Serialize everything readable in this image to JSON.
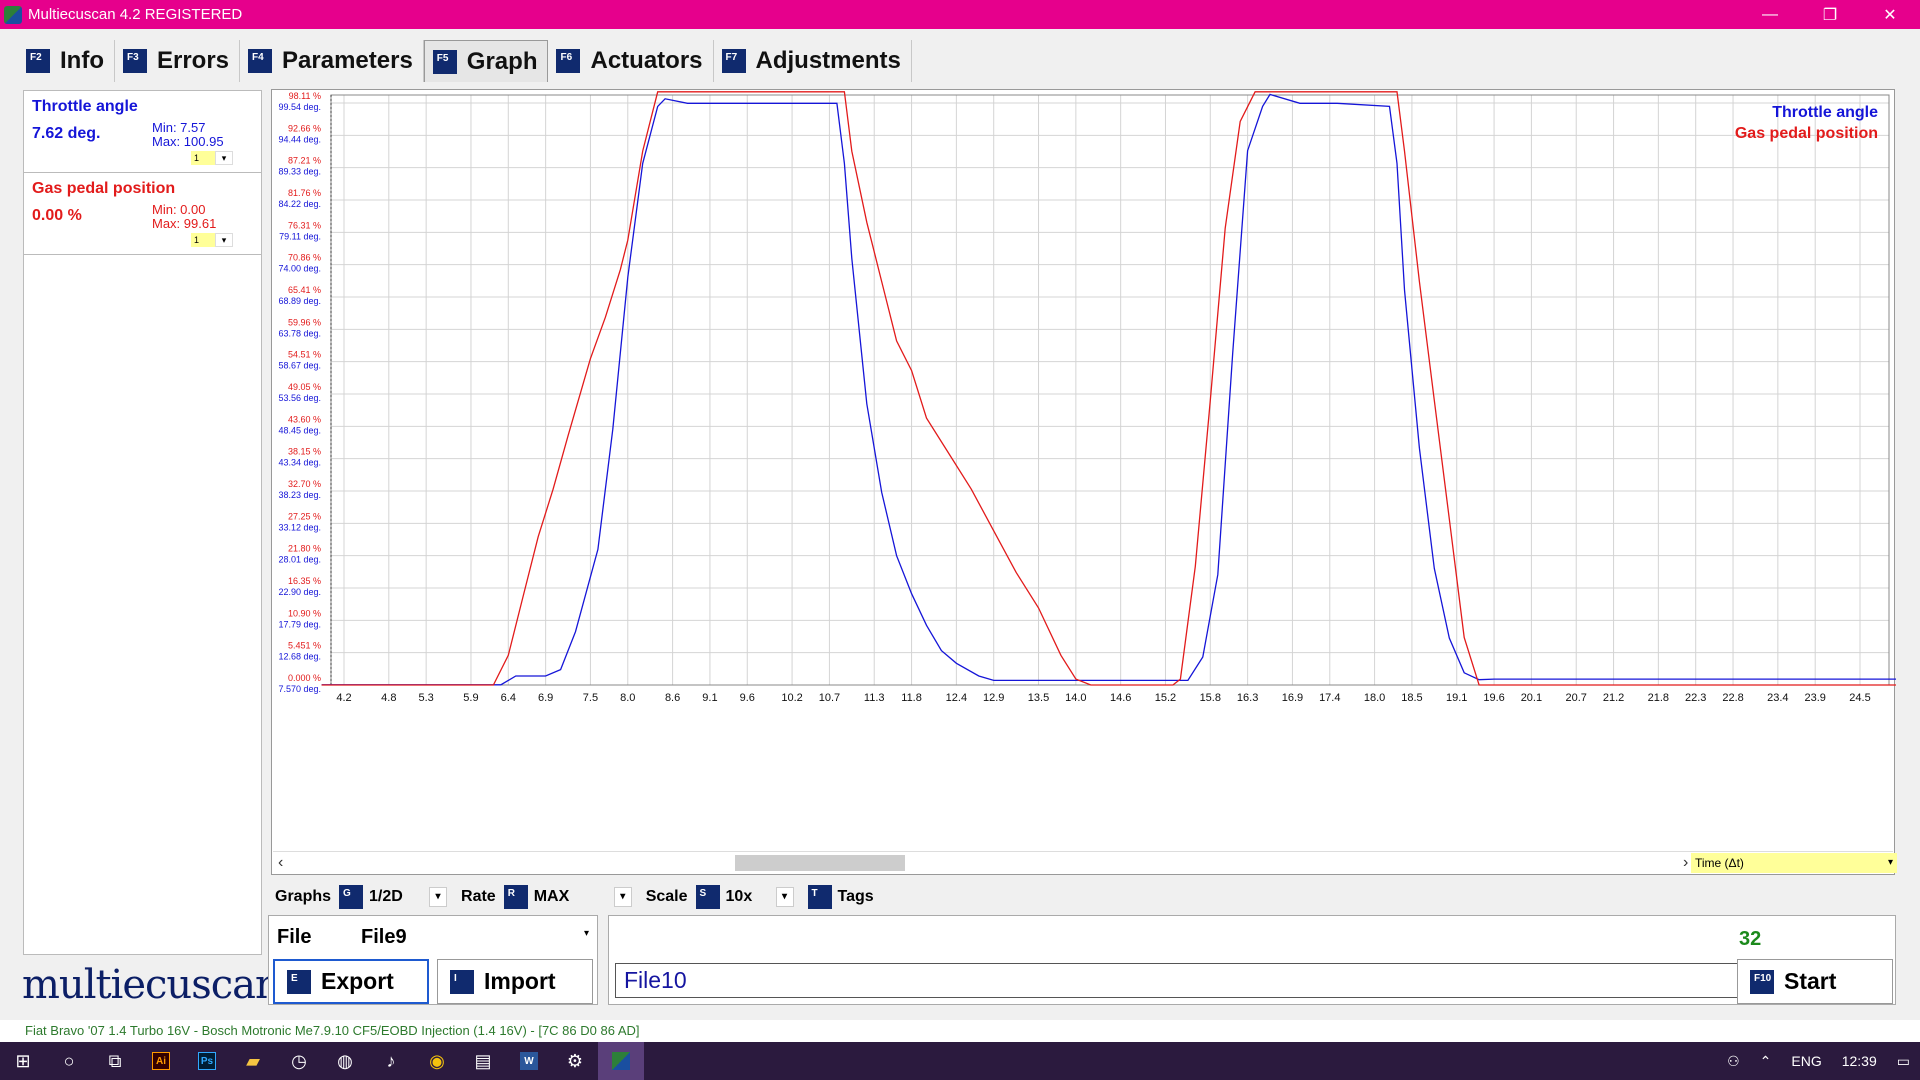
{
  "window": {
    "title": "Multiecuscan 4.2 REGISTERED",
    "min": "—",
    "restore": "❐",
    "close": "✕"
  },
  "tabs": [
    {
      "key": "F2",
      "label": "Info"
    },
    {
      "key": "F3",
      "label": "Errors"
    },
    {
      "key": "F4",
      "label": "Parameters"
    },
    {
      "key": "F5",
      "label": "Graph"
    },
    {
      "key": "F6",
      "label": "Actuators"
    },
    {
      "key": "F7",
      "label": "Adjustments"
    }
  ],
  "signals": [
    {
      "name": "Throttle angle",
      "value": "7.62 deg.",
      "min": "Min: 7.57",
      "max": "Max: 100.95",
      "scale": "1",
      "color": "#1515d8"
    },
    {
      "name": "Gas pedal position",
      "value": "0.00 %",
      "min": "Min: 0.00",
      "max": "Max: 99.61",
      "scale": "1",
      "color": "#e21b1b"
    }
  ],
  "logo": "multiecuscan",
  "chart_data": {
    "type": "line",
    "title": "",
    "xlabel": "Time (Δt)",
    "x_ticks": [
      "4.2",
      "4.8",
      "5.3",
      "5.9",
      "6.4",
      "6.9",
      "7.5",
      "8.0",
      "8.6",
      "9.1",
      "9.6",
      "10.2",
      "10.7",
      "11.3",
      "11.8",
      "12.4",
      "12.9",
      "13.5",
      "14.0",
      "14.6",
      "15.2",
      "15.8",
      "16.3",
      "16.9",
      "17.4",
      "18.0",
      "18.5",
      "19.1",
      "19.6",
      "20.1",
      "20.7",
      "21.2",
      "21.8",
      "22.3",
      "22.8",
      "23.4",
      "23.9",
      "24.5"
    ],
    "y_ticks_pedal": [
      "0.000 %",
      "5.451 %",
      "10.90 %",
      "16.35 %",
      "21.80 %",
      "27.25 %",
      "32.70 %",
      "38.15 %",
      "43.60 %",
      "49.05 %",
      "54.51 %",
      "59.96 %",
      "65.41 %",
      "70.86 %",
      "76.31 %",
      "81.76 %",
      "87.21 %",
      "92.66 %",
      "98.11 %"
    ],
    "y_ticks_throttle": [
      "7.570 deg.",
      "12.68 deg.",
      "17.79 deg.",
      "22.90 deg.",
      "28.01 deg.",
      "33.12 deg.",
      "38.23 deg.",
      "43.34 deg.",
      "48.45 deg.",
      "53.56 deg.",
      "58.67 deg.",
      "63.78 deg.",
      "68.89 deg.",
      "74.00 deg.",
      "79.11 deg.",
      "84.22 deg.",
      "89.33 deg.",
      "94.44 deg.",
      "99.54 deg."
    ],
    "pedal_range": [
      0,
      98.11
    ],
    "throttle_range": [
      7.57,
      99.54
    ],
    "grid": true,
    "legend": "top-right",
    "series": [
      {
        "name": "Throttle angle",
        "color": "#1515d8",
        "x": [
          3.9,
          6.3,
          6.5,
          6.9,
          7.1,
          7.3,
          7.6,
          7.8,
          8.0,
          8.2,
          8.4,
          8.5,
          8.8,
          9.5,
          10.0,
          10.8,
          10.9,
          11.0,
          11.2,
          11.4,
          11.6,
          11.8,
          12.0,
          12.2,
          12.4,
          12.7,
          12.9,
          15.5,
          15.7,
          15.9,
          16.1,
          16.3,
          16.5,
          16.6,
          17.0,
          17.5,
          18.2,
          18.3,
          18.4,
          18.6,
          18.8,
          19.0,
          19.2,
          19.4,
          19.6,
          25.1
        ],
        "y": [
          7.6,
          7.6,
          9.0,
          9.0,
          10.0,
          16.0,
          29.0,
          48.0,
          72.0,
          90.0,
          99.0,
          100.2,
          99.5,
          99.5,
          99.5,
          99.5,
          90.0,
          75.0,
          52.0,
          38.0,
          28.0,
          22.0,
          17.0,
          13.0,
          11.0,
          9.0,
          8.3,
          8.3,
          12.0,
          25.0,
          60.0,
          92.0,
          99.0,
          100.9,
          99.5,
          99.5,
          99.0,
          90.0,
          70.0,
          45.0,
          26.0,
          15.0,
          9.5,
          8.4,
          8.5,
          8.5
        ]
      },
      {
        "name": "Gas pedal position",
        "color": "#e21b1b",
        "x": [
          3.9,
          6.2,
          6.4,
          6.6,
          6.8,
          7.0,
          7.2,
          7.5,
          7.7,
          7.9,
          8.0,
          8.2,
          8.4,
          10.9,
          11.0,
          11.2,
          11.4,
          11.6,
          11.8,
          12.0,
          12.3,
          12.6,
          12.9,
          13.2,
          13.5,
          13.8,
          14.0,
          14.2,
          15.3,
          15.4,
          15.6,
          15.8,
          16.0,
          16.2,
          16.4,
          16.5,
          18.3,
          18.4,
          18.6,
          18.8,
          19.0,
          19.2,
          19.4,
          25.1
        ],
        "y": [
          0.0,
          0.0,
          5.0,
          15.0,
          25.0,
          33.0,
          42.0,
          55.0,
          62.0,
          70.0,
          75.0,
          90.0,
          100.0,
          100.0,
          90.0,
          78.0,
          68.0,
          58.0,
          53.0,
          45.0,
          39.0,
          33.0,
          26.0,
          19.0,
          13.0,
          5.0,
          1.0,
          0.0,
          0.0,
          1.0,
          20.0,
          48.0,
          77.0,
          95.0,
          100.0,
          100.0,
          100.0,
          90.0,
          68.0,
          48.0,
          28.0,
          8.0,
          0.0,
          0.0
        ]
      }
    ]
  },
  "time_select": {
    "value": "Time (Δt)"
  },
  "controls": {
    "graphs_label": "Graphs",
    "graphs_key": "G",
    "graphs_value": "1/2D",
    "rate_label": "Rate",
    "rate_key": "R",
    "rate_value": "MAX",
    "scale_label": "Scale",
    "scale_key": "S",
    "scale_value": "10x",
    "tags_key": "T",
    "tags_label": "Tags"
  },
  "file": {
    "label": "File",
    "value": "File9"
  },
  "buttons": {
    "export_key": "E",
    "export": "Export",
    "import_key": "I",
    "import": "Import",
    "start_key": "F10",
    "start": "Start"
  },
  "counter": "32",
  "file_name": "File10",
  "status": "Fiat Bravo '07 1.4 Turbo 16V - Bosch Motronic Me7.9.10 CF5/EOBD Injection (1.4 16V) - [7C 86 D0 86 AD]",
  "taskbar": {
    "lang": "ENG",
    "time": "12:39",
    "ai": "Ai",
    "ps": "Ps",
    "word": "W"
  }
}
